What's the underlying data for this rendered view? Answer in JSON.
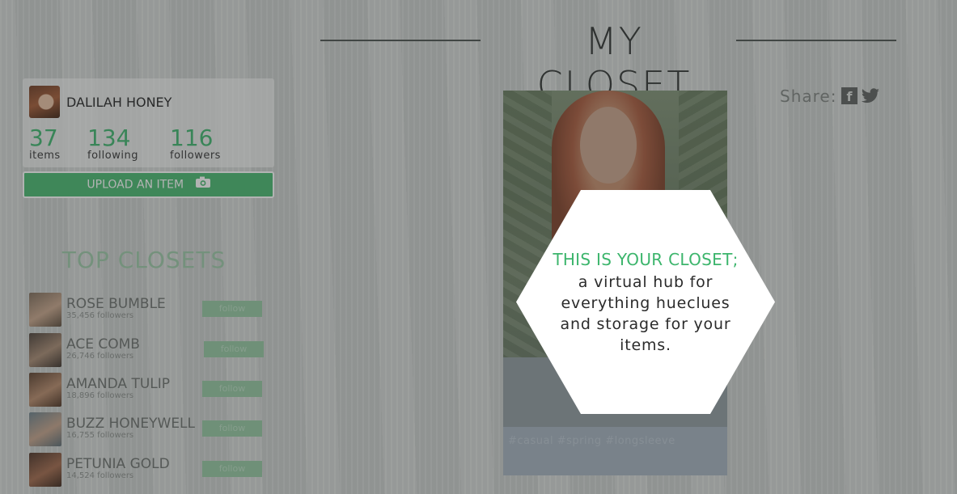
{
  "header": {
    "title": "MY CLOSET"
  },
  "profile": {
    "name": "DALILAH HONEY",
    "stats": [
      {
        "value": "37",
        "label": "items"
      },
      {
        "value": "134",
        "label": "following"
      },
      {
        "value": "116",
        "label": "followers"
      }
    ],
    "upload_label": "UPLOAD AN ITEM",
    "upload_icon": "camera-icon"
  },
  "top_closets": {
    "title": "TOP CLOSETS",
    "items": [
      {
        "name": "ROSE BUMBLE",
        "followers": "35,456 followers",
        "follow_label": "follow"
      },
      {
        "name": "ACE COMB",
        "followers": "26,746 followers",
        "follow_label": "follow"
      },
      {
        "name": "AMANDA TULIP",
        "followers": "18,896 followers",
        "follow_label": "follow"
      },
      {
        "name": "BUZZ HONEYWELL",
        "followers": "16,755 followers",
        "follow_label": "follow"
      },
      {
        "name": "PETUNIA GOLD",
        "followers": "14,524 followers",
        "follow_label": "follow"
      }
    ]
  },
  "share": {
    "label": "Share:",
    "icons": [
      "facebook-icon",
      "twitter-icon"
    ]
  },
  "photo": {
    "caption": "#casual #spring #longsleeve"
  },
  "callout": {
    "headline": "THIS IS YOUR CLOSET;",
    "body": "a virtual hub for everything hueclues and storage for your items."
  },
  "colors": {
    "accent": "#3cb56c",
    "button": "#46b96f",
    "overlay": "#343836"
  }
}
